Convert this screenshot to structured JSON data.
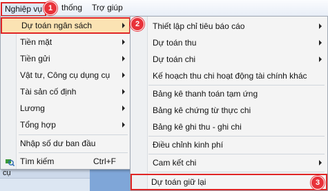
{
  "menubar": {
    "nghiep_vu": "Nghiệp vụ",
    "he_thong": "thống",
    "tro_giup": "Trợ giúp"
  },
  "badges": [
    "1",
    "2",
    "3"
  ],
  "menu1": {
    "items": [
      {
        "label": "Dự toán ngân sách",
        "submenu": true
      },
      {
        "label": "Tiền mặt",
        "submenu": true
      },
      {
        "label": "Tiền gửi",
        "submenu": true
      },
      {
        "label": "Vật tư, Công cụ dụng cụ",
        "submenu": true
      },
      {
        "label": "Tài sản cố định",
        "submenu": true
      },
      {
        "label": "Lương",
        "submenu": true
      },
      {
        "label": "Tổng hợp",
        "submenu": true
      },
      {
        "label": "Nhập số dư ban đầu",
        "submenu": false
      },
      {
        "label": "Tìm kiếm",
        "shortcut": "Ctrl+F"
      }
    ]
  },
  "menu2": {
    "items": [
      {
        "label": "Thiết lập chỉ tiêu báo cáo",
        "submenu": true
      },
      {
        "label": "Dự toán thu",
        "submenu": true
      },
      {
        "label": "Dự toán chi",
        "submenu": true
      },
      {
        "label": "Kế hoạch thu chi hoạt động tài chính khác"
      },
      {
        "label": "Bảng kê thanh toán tạm ứng"
      },
      {
        "label": "Bảng kê chứng từ thực chi"
      },
      {
        "label": "Bảng kê ghi thu - ghi chi"
      },
      {
        "label": "Điều chỉnh kinh phí"
      },
      {
        "label": "Cam kết chi",
        "submenu": true
      },
      {
        "label": "Dự toán giữ lại"
      }
    ]
  },
  "background": {
    "left_header": "cụ"
  }
}
